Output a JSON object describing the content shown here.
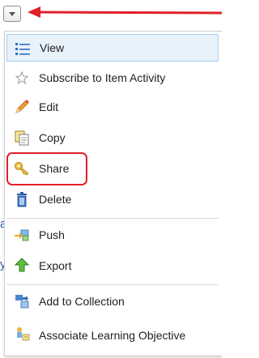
{
  "menu": {
    "items": [
      {
        "label": "View",
        "icon": "list-icon"
      },
      {
        "label": "Subscribe to Item Activity",
        "icon": "star-icon"
      },
      {
        "label": "Edit",
        "icon": "pencil-icon"
      },
      {
        "label": "Copy",
        "icon": "copy-icon"
      },
      {
        "label": "Share",
        "icon": "key-icon"
      },
      {
        "label": "Delete",
        "icon": "trash-icon"
      },
      {
        "label": "Push",
        "icon": "push-icon"
      },
      {
        "label": "Export",
        "icon": "export-icon"
      },
      {
        "label": "Add to Collection",
        "icon": "collection-icon"
      },
      {
        "label": "Associate Learning Objective",
        "icon": "learning-objective-icon"
      }
    ],
    "selected": "View",
    "highlighted": "Copy"
  },
  "background_fragments": {
    "frag1": "a",
    "frag2": "y"
  },
  "colors": {
    "highlight_border": "#e0202a",
    "arrow": "#e0202a",
    "selected_bg": "#e8f2fb",
    "selected_border": "#a7cdef"
  }
}
